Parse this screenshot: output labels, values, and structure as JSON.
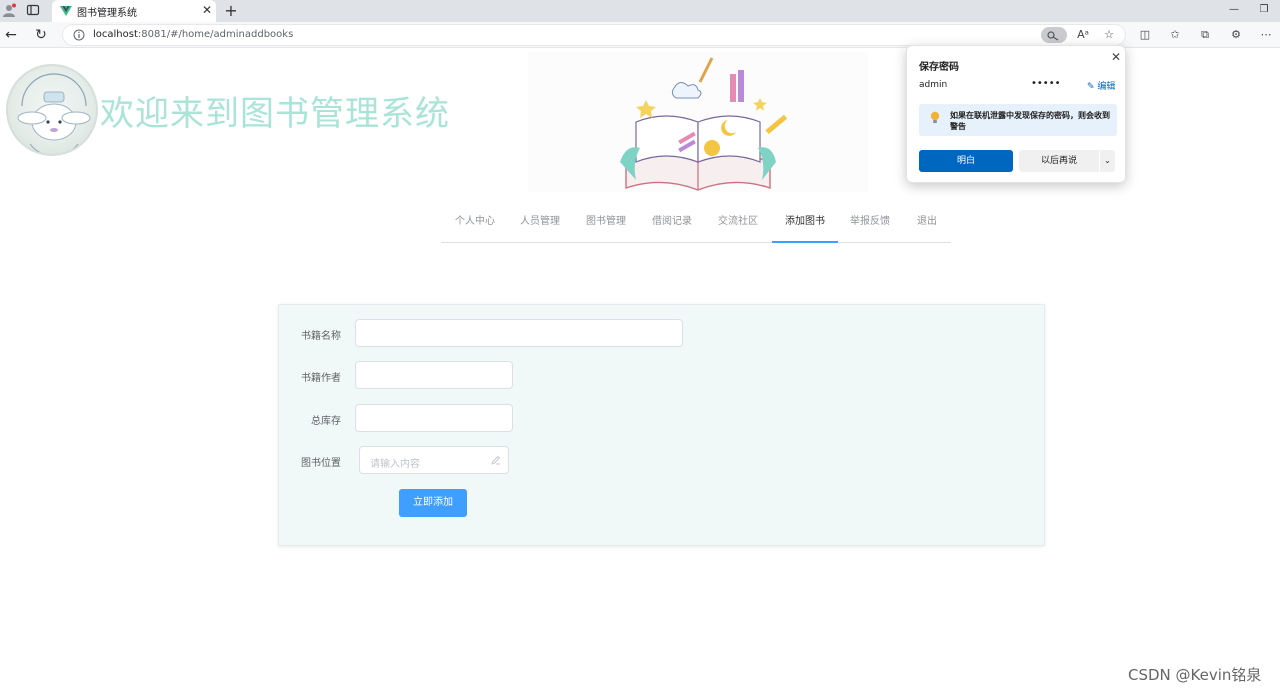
{
  "browser": {
    "tab_title": "图书管理系统",
    "url_host": "localhost",
    "url_rest": ":8081/#/home/adminaddbooks"
  },
  "header": {
    "site_title": "欢迎来到图书管理系统",
    "logo_alt": "Cinnamoroll 15th Anniversary"
  },
  "nav": {
    "items": [
      {
        "label": "个人中心"
      },
      {
        "label": "人员管理"
      },
      {
        "label": "图书管理"
      },
      {
        "label": "借阅记录"
      },
      {
        "label": "交流社区"
      },
      {
        "label": "添加图书"
      },
      {
        "label": "举报反馈"
      },
      {
        "label": "退出"
      }
    ],
    "active": "添加图书"
  },
  "form": {
    "book_name_label": "书籍名称",
    "book_name_value": "",
    "author_label": "书籍作者",
    "author_value": "",
    "stock_label": "总库存",
    "stock_value": "",
    "location_label": "图书位置",
    "location_placeholder": "请输入内容",
    "submit_label": "立即添加"
  },
  "password_popup": {
    "title": "保存密码",
    "username": "admin",
    "password_mask": "•••••",
    "edit_label": "编辑",
    "warning": "如果在联机泄露中发现保存的密码，则会收到警告",
    "confirm_label": "明白",
    "later_label": "以后再说"
  },
  "watermark": "CSDN @Kevin铭泉",
  "colors": {
    "accent": "#409eff",
    "title_teal": "#a9e4d7",
    "card_bg": "#f0f9f7",
    "edge_blue": "#0067c0"
  }
}
